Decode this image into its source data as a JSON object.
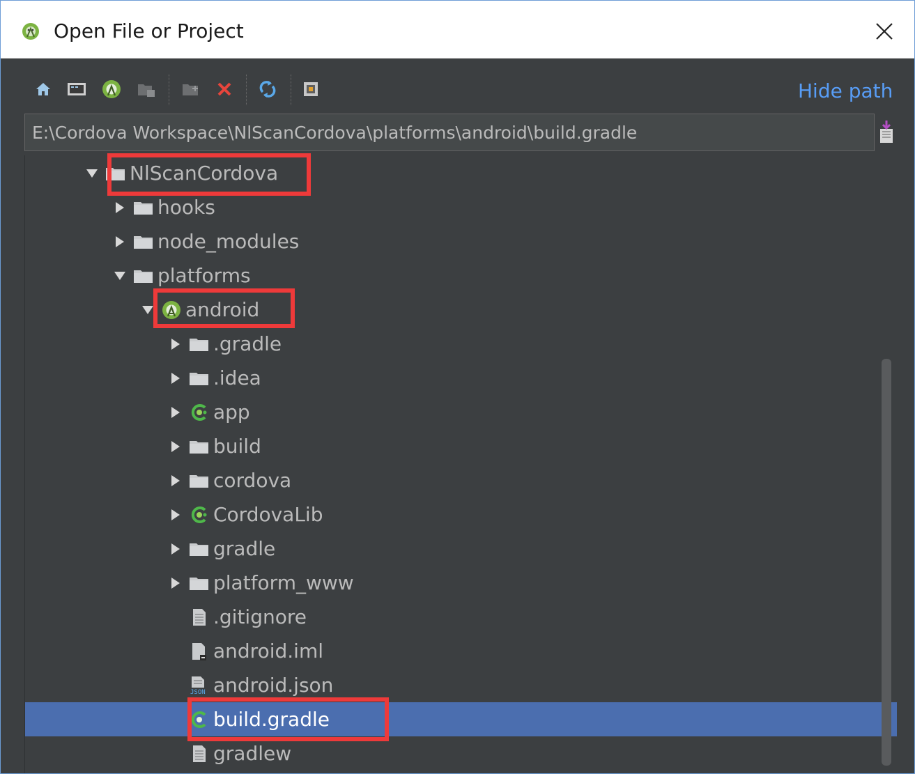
{
  "dialog": {
    "title": "Open File or Project",
    "title_icon": "android-studio-icon",
    "close_icon": "close-icon"
  },
  "toolbar": {
    "buttons": [
      {
        "name": "home-icon"
      },
      {
        "name": "desktop-icon"
      },
      {
        "name": "project-icon"
      },
      {
        "name": "module-icon"
      },
      {
        "name": "new-folder-icon"
      },
      {
        "name": "delete-icon"
      },
      {
        "name": "refresh-icon"
      },
      {
        "name": "show-hidden-icon"
      }
    ],
    "hide_path": "Hide path"
  },
  "path": {
    "value": "E:\\Cordova Workspace\\NlScanCordova\\platforms\\android\\build.gradle"
  },
  "tree": [
    {
      "label": "NlScanCordova",
      "icon": "folder-icon",
      "expanded": true,
      "depth": 0
    },
    {
      "label": "hooks",
      "icon": "folder-icon",
      "expanded": false,
      "depth": 1
    },
    {
      "label": "node_modules",
      "icon": "folder-icon",
      "expanded": false,
      "depth": 1
    },
    {
      "label": "platforms",
      "icon": "folder-icon",
      "expanded": true,
      "depth": 1
    },
    {
      "label": "android",
      "icon": "android-project-icon",
      "expanded": true,
      "depth": 2
    },
    {
      "label": ".gradle",
      "icon": "folder-icon",
      "expanded": false,
      "depth": 3
    },
    {
      "label": ".idea",
      "icon": "folder-icon",
      "expanded": false,
      "depth": 3
    },
    {
      "label": "app",
      "icon": "gradle-module-icon",
      "expanded": false,
      "depth": 3
    },
    {
      "label": "build",
      "icon": "folder-icon",
      "expanded": false,
      "depth": 3
    },
    {
      "label": "cordova",
      "icon": "folder-icon",
      "expanded": false,
      "depth": 3
    },
    {
      "label": "CordovaLib",
      "icon": "gradle-module-icon",
      "expanded": false,
      "depth": 3
    },
    {
      "label": "gradle",
      "icon": "folder-icon",
      "expanded": false,
      "depth": 3
    },
    {
      "label": "platform_www",
      "icon": "folder-icon",
      "expanded": false,
      "depth": 3
    },
    {
      "label": ".gitignore",
      "icon": "text-file-icon",
      "depth": 3
    },
    {
      "label": "android.iml",
      "icon": "iml-file-icon",
      "depth": 3
    },
    {
      "label": "android.json",
      "icon": "json-file-icon",
      "depth": 3
    },
    {
      "label": "build.gradle",
      "icon": "gradle-file-icon",
      "depth": 3,
      "selected": true
    },
    {
      "label": "gradlew",
      "icon": "text-file-icon",
      "depth": 3
    }
  ],
  "colors": {
    "selection": "#4b6eaf",
    "annotation": "#ee3a3a",
    "link": "#589df6"
  }
}
